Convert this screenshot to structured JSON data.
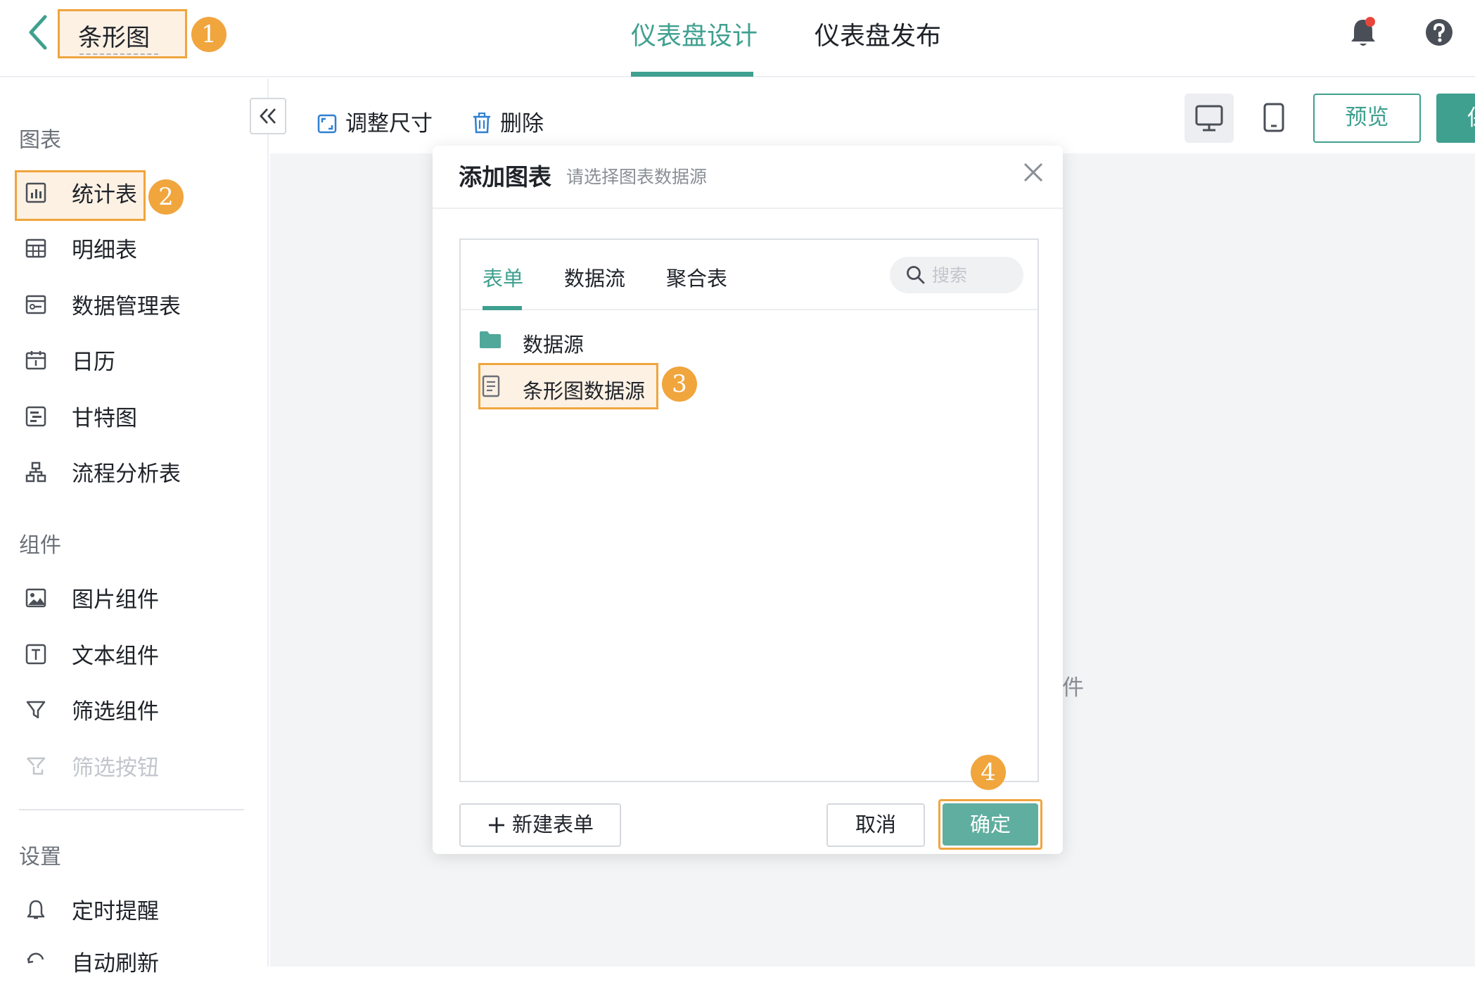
{
  "header": {
    "back_icon": "chevron-left-icon",
    "title": "条形图",
    "tabs": [
      {
        "label": "仪表盘设计",
        "active": true
      },
      {
        "label": "仪表盘发布",
        "active": false
      }
    ],
    "notification_icon": "bell-icon",
    "help_icon": "help-icon"
  },
  "badges": [
    "1",
    "2",
    "3",
    "4"
  ],
  "sidebar": {
    "sections": [
      {
        "title": "图表",
        "items": [
          {
            "label": "统计表",
            "icon": "bar-chart-icon"
          },
          {
            "label": "明细表",
            "icon": "table-icon"
          },
          {
            "label": "数据管理表",
            "icon": "data-manage-icon"
          },
          {
            "label": "日历",
            "icon": "calendar-icon"
          },
          {
            "label": "甘特图",
            "icon": "gantt-icon"
          },
          {
            "label": "流程分析表",
            "icon": "flow-icon"
          }
        ]
      },
      {
        "title": "组件",
        "items": [
          {
            "label": "图片组件",
            "icon": "image-icon"
          },
          {
            "label": "文本组件",
            "icon": "text-icon"
          },
          {
            "label": "筛选组件",
            "icon": "filter-icon"
          },
          {
            "label": "筛选按钮",
            "icon": "filter-button-icon",
            "disabled": true
          }
        ]
      },
      {
        "title": "设置",
        "items": [
          {
            "label": "定时提醒",
            "icon": "bell-outline-icon"
          },
          {
            "label": "自动刷新",
            "icon": "refresh-icon"
          }
        ]
      }
    ]
  },
  "toolbar": {
    "collapse_icon": "double-chevron-left-icon",
    "resize_label": "调整尺寸",
    "delete_label": "删除",
    "preview_label": "预览",
    "publish_label": "保存"
  },
  "canvas": {
    "ghost_text": "件"
  },
  "modal": {
    "title": "添加图表",
    "subtitle": "请选择图表数据源",
    "tabs": [
      {
        "label": "表单",
        "active": true
      },
      {
        "label": "数据流",
        "active": false
      },
      {
        "label": "聚合表",
        "active": false
      }
    ],
    "search_placeholder": "搜索",
    "tree": [
      {
        "label": "数据源",
        "icon": "folder-icon"
      },
      {
        "label": "条形图数据源",
        "icon": "form-doc-icon"
      }
    ],
    "new_button": "新建表单",
    "cancel_button": "取消",
    "confirm_button": "确定"
  },
  "colors": {
    "accent": "#3fa08f",
    "highlight": "#f0a53d",
    "highlight_bg": "#fdf1e4"
  }
}
